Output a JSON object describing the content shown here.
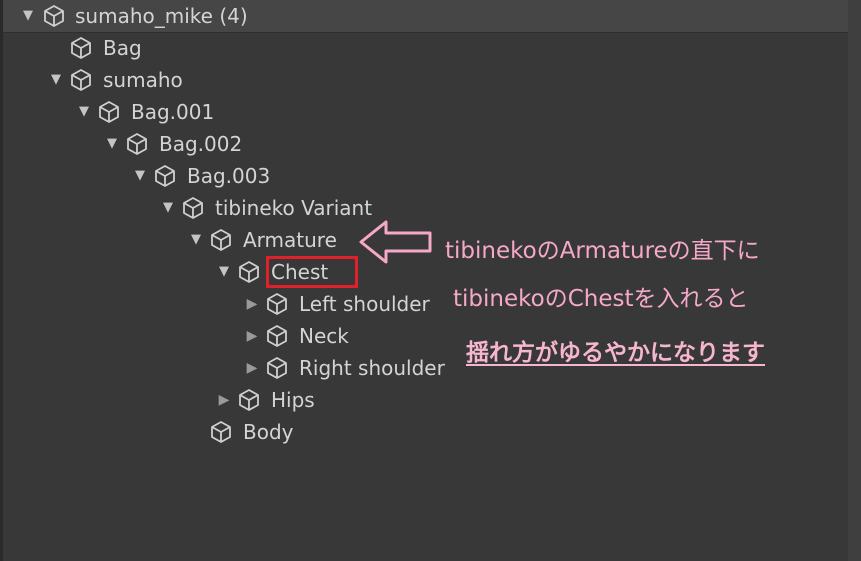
{
  "hierarchy": {
    "root": {
      "arrow": "▼",
      "label": "sumaho_mike (4)"
    },
    "items": [
      {
        "label": "Bag"
      },
      {
        "arrow": "▼",
        "label": "sumaho"
      },
      {
        "arrow": "▼",
        "label": "Bag.001"
      },
      {
        "arrow": "▼",
        "label": "Bag.002"
      },
      {
        "arrow": "▼",
        "label": "Bag.003"
      },
      {
        "arrow": "▼",
        "label": "tibineko Variant"
      },
      {
        "arrow": "▼",
        "label": "Armature"
      },
      {
        "arrow": "▼",
        "label": "Chest"
      },
      {
        "arrow": "▶",
        "label": "Left shoulder"
      },
      {
        "arrow": "▶",
        "label": "Neck"
      },
      {
        "arrow": "▶",
        "label": "Right shoulder"
      },
      {
        "arrow": "▶",
        "label": "Hips"
      },
      {
        "label": "Body"
      }
    ]
  },
  "annotation": {
    "line1": "tibinekoのArmatureの直下に",
    "line2": "tibinekoのChestを入れると",
    "line3": "揺れ方がゆるやかになります",
    "text_color": "#f5a8c8",
    "highlight_color": "#e0202a",
    "arrow_icon": "left-arrow-outline-icon"
  },
  "icons": {
    "node": "cube-icon",
    "expanded": "triangle-down-icon",
    "collapsed": "triangle-right-icon"
  }
}
